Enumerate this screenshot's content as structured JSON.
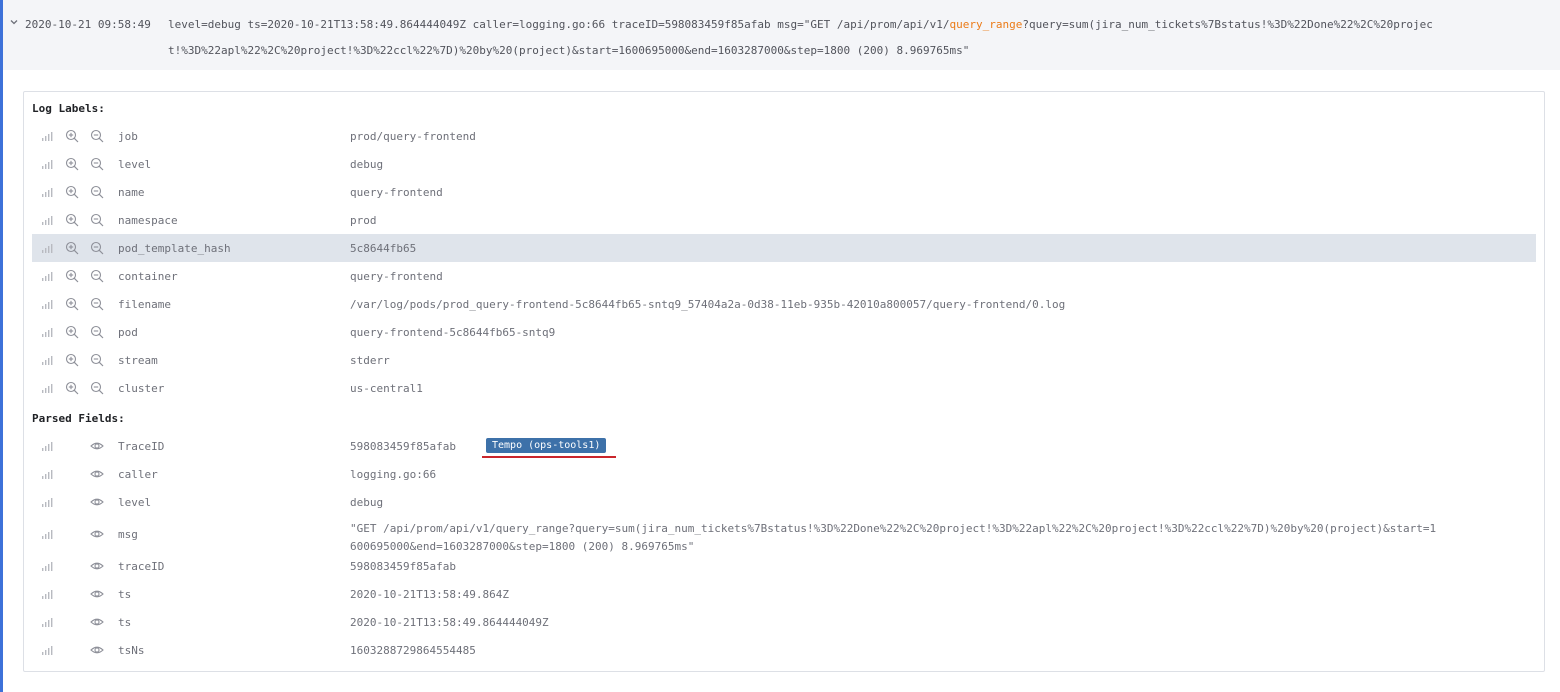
{
  "log_row": {
    "timestamp": "2020-10-21 09:58:49",
    "line1_before": "level=debug ts=2020-10-21T13:58:49.864444049Z caller=logging.go:66 traceID=598083459f85afab msg=\"GET /api/prom/api/v1/",
    "line1_highlight": "query_range",
    "line1_after": "?query=sum(jira_num_tickets%7Bstatus!%3D%22Done%22%2C%20projec",
    "line2": "t!%3D%22apl%22%2C%20project!%3D%22ccl%22%7D)%20by%20(project)&start=1600695000&end=1603287000&step=1800 (200) 8.969765ms\"",
    "highlight_color": "#eb7b18"
  },
  "log_labels": {
    "title": "Log Labels:",
    "items": [
      {
        "key": "job",
        "value": "prod/query-frontend"
      },
      {
        "key": "level",
        "value": "debug"
      },
      {
        "key": "name",
        "value": "query-frontend"
      },
      {
        "key": "namespace",
        "value": "prod"
      },
      {
        "key": "pod_template_hash",
        "value": "5c8644fb65"
      },
      {
        "key": "container",
        "value": "query-frontend"
      },
      {
        "key": "filename",
        "value": "/var/log/pods/prod_query-frontend-5c8644fb65-sntq9_57404a2a-0d38-11eb-935b-42010a800057/query-frontend/0.log"
      },
      {
        "key": "pod",
        "value": "query-frontend-5c8644fb65-sntq9"
      },
      {
        "key": "stream",
        "value": "stderr"
      },
      {
        "key": "cluster",
        "value": "us-central1"
      }
    ]
  },
  "parsed_fields": {
    "title": "Parsed Fields:",
    "items": [
      {
        "key": "TraceID",
        "value": "598083459f85afab",
        "link_label": "Tempo (ops-tools1)"
      },
      {
        "key": "caller",
        "value": "logging.go:66"
      },
      {
        "key": "level",
        "value": "debug"
      },
      {
        "key": "msg",
        "value": "\"GET /api/prom/api/v1/query_range?query=sum(jira_num_tickets%7Bstatus!%3D%22Done%22%2C%20project!%3D%22apl%22%2C%20project!%3D%22ccl%22%7D)%20by%20(project)&start=1\n600695000&end=1603287000&step=1800 (200) 8.969765ms\""
      },
      {
        "key": "traceID",
        "value": "598083459f85afab"
      },
      {
        "key": "ts",
        "value": "2020-10-21T13:58:49.864Z"
      },
      {
        "key": "ts",
        "value": "2020-10-21T13:58:49.864444049Z"
      },
      {
        "key": "tsNs",
        "value": "1603288729864554485"
      }
    ]
  },
  "icons": {
    "chevron": "chevron-down-icon",
    "stats": "stats-bars-icon",
    "filter_for": "zoom-in-icon",
    "filter_out": "zoom-out-icon",
    "toggle": "eye-icon"
  },
  "colors": {
    "accent": "#3d71d9",
    "link_badge": "#3d71a9",
    "underline": "#c9262c",
    "hover_row": "#dfe4eb"
  }
}
